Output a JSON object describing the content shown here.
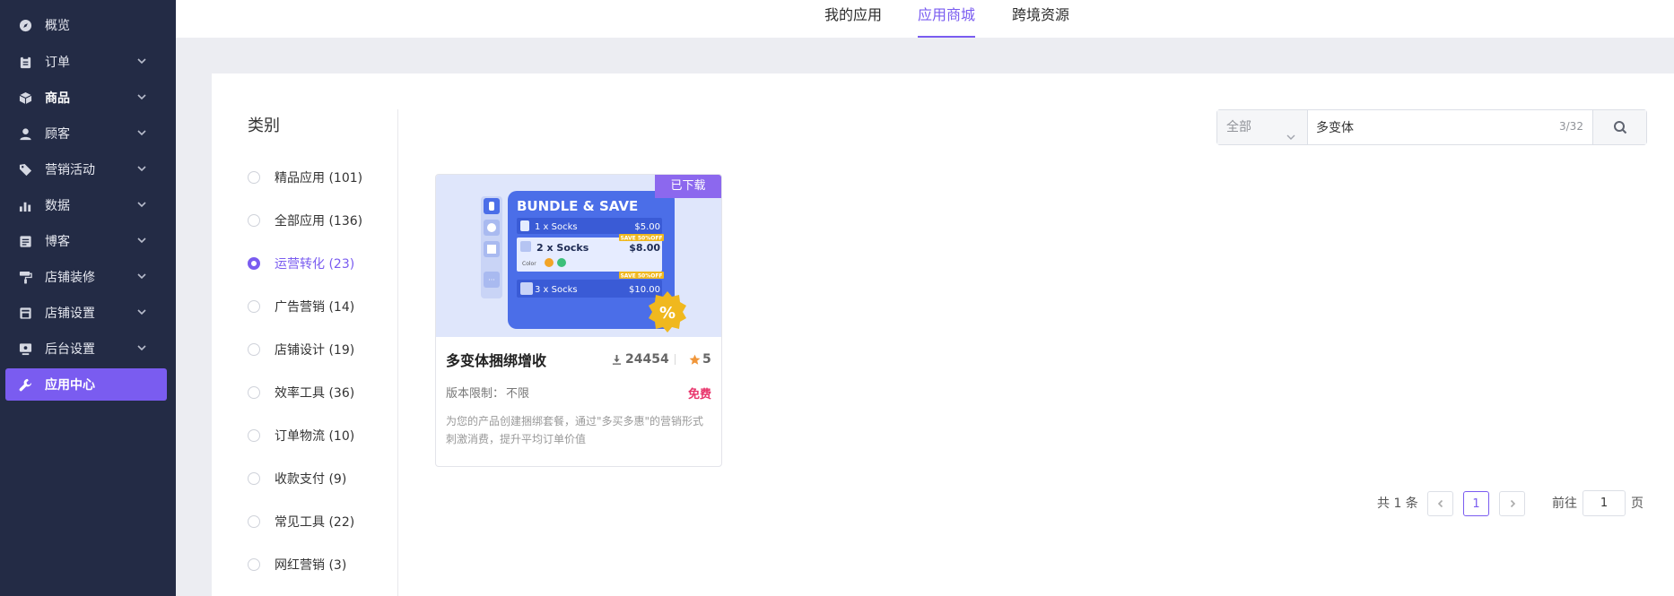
{
  "sidebar": {
    "items": [
      {
        "label": "概览",
        "icon": "compass-icon",
        "chevron": false
      },
      {
        "label": "订单",
        "icon": "clipboard-icon",
        "chevron": true
      },
      {
        "label": "商品",
        "icon": "cube-icon",
        "chevron": true
      },
      {
        "label": "顾客",
        "icon": "user-icon",
        "chevron": true
      },
      {
        "label": "营销活动",
        "icon": "tag-icon",
        "chevron": true
      },
      {
        "label": "数据",
        "icon": "bar-chart-icon",
        "chevron": true
      },
      {
        "label": "博客",
        "icon": "blog-icon",
        "chevron": true
      },
      {
        "label": "店铺装修",
        "icon": "paint-roller-icon",
        "chevron": true
      },
      {
        "label": "店铺设置",
        "icon": "store-icon",
        "chevron": true
      },
      {
        "label": "后台设置",
        "icon": "monitor-icon",
        "chevron": true
      },
      {
        "label": "应用中心",
        "icon": "wrench-icon",
        "chevron": false
      }
    ]
  },
  "tabs": [
    {
      "label": "我的应用"
    },
    {
      "label": "应用商城"
    },
    {
      "label": "跨境资源"
    }
  ],
  "categories": {
    "title": "类别",
    "items": [
      {
        "label": "精品应用 (101)"
      },
      {
        "label": "全部应用 (136)"
      },
      {
        "label": "运营转化 (23)"
      },
      {
        "label": "广告营销 (14)"
      },
      {
        "label": "店铺设计 (19)"
      },
      {
        "label": "效率工具 (36)"
      },
      {
        "label": "订单物流 (10)"
      },
      {
        "label": "收款支付 (9)"
      },
      {
        "label": "常见工具 (22)"
      },
      {
        "label": "网红营销 (3)"
      }
    ]
  },
  "search": {
    "scope": "全部",
    "value": "多变体",
    "counter": "3/32"
  },
  "app_card": {
    "ribbon": "已下载",
    "title": "多变体捆绑增收",
    "downloads": "24454",
    "rating": "5",
    "limit_label": "版本限制：",
    "limit_value": "不限",
    "price": "免费",
    "description": "为您的产品创建捆绑套餐，通过\"多买多惠\"的营销形式刺激消费，提升平均订单价值",
    "image": {
      "heading": "BUNDLE & SAVE",
      "row1_label": "1 x Socks",
      "row1_price": "$5.00",
      "row2_label": "2 x Socks",
      "row2_price": "$8.00",
      "row2_badge": "SAVE 50%OFF",
      "color_label": "Color",
      "row3_label": "3 x Socks",
      "row3_price": "$10.00",
      "row3_badge": "SAVE 50%OFF",
      "discount_symbol": "%"
    }
  },
  "pagination": {
    "total": "共 1 条",
    "current": "1",
    "goto_label": "前往",
    "goto_value": "1",
    "goto_unit": "页"
  },
  "colors": {
    "accent": "#7a5cf0",
    "sidebar_bg": "#232b45",
    "price": "#e8346b",
    "ribbon": "#8c68ee"
  }
}
